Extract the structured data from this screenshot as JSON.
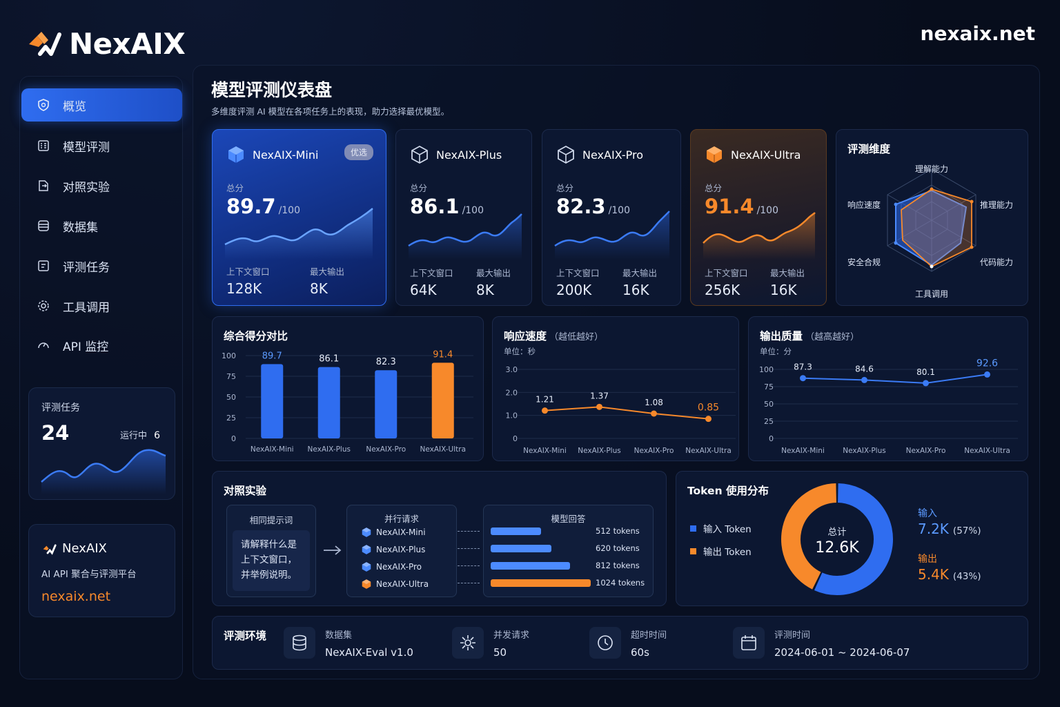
{
  "brand": {
    "logo_text": "NexAIX",
    "domain": "nexaix.net"
  },
  "sidebar": {
    "items": [
      {
        "label": "概览",
        "icon": "shield-icon",
        "active": true
      },
      {
        "label": "模型评测",
        "icon": "grid-icon",
        "active": false
      },
      {
        "label": "对照实验",
        "icon": "compare-icon",
        "active": false
      },
      {
        "label": "数据集",
        "icon": "database-icon",
        "active": false
      },
      {
        "label": "评测任务",
        "icon": "task-icon",
        "active": false
      },
      {
        "label": "工具调用",
        "icon": "gear-icon",
        "active": false
      },
      {
        "label": "API 监控",
        "icon": "gauge-icon",
        "active": false
      }
    ],
    "task_card": {
      "title": "评测任务",
      "count": "24",
      "running_label": "运行中",
      "running_count": "6"
    },
    "brand_card": {
      "name": "NexAIX",
      "tagline": "AI API 聚合与评测平台",
      "url": "nexaix.net"
    }
  },
  "page": {
    "title": "模型评测仪表盘",
    "subtitle": "多维度评测 AI 模型在各项任务上的表现，助力选择最优模型。"
  },
  "models": [
    {
      "name": "NexAIX-Mini",
      "badge": "优选",
      "score_label": "总分",
      "score": "89.7",
      "score_max": "/100",
      "ctx_label": "上下文窗口",
      "ctx": "128K",
      "out_label": "最大输出",
      "out": "8K"
    },
    {
      "name": "NexAIX-Plus",
      "badge": "",
      "score_label": "总分",
      "score": "86.1",
      "score_max": "/100",
      "ctx_label": "上下文窗口",
      "ctx": "64K",
      "out_label": "最大输出",
      "out": "8K"
    },
    {
      "name": "NexAIX-Pro",
      "badge": "",
      "score_label": "总分",
      "score": "82.3",
      "score_max": "/100",
      "ctx_label": "上下文窗口",
      "ctx": "200K",
      "out_label": "最大输出",
      "out": "16K"
    },
    {
      "name": "NexAIX-Ultra",
      "badge": "",
      "score_label": "总分",
      "score": "91.4",
      "score_max": "/100",
      "ctx_label": "上下文窗口",
      "ctx": "256K",
      "out_label": "最大输出",
      "out": "16K"
    }
  ],
  "radar": {
    "title": "评测维度",
    "axes": [
      "理解能力",
      "推理能力",
      "代码能力",
      "工具调用",
      "安全合规",
      "响应速度"
    ]
  },
  "charts": {
    "score_title": "综合得分对比",
    "speed_title": "响应速度",
    "speed_hint": "（越低越好）",
    "speed_unit": "单位：秒",
    "quality_title": "输出质量",
    "quality_hint": "（越高越好）",
    "quality_unit": "单位：分"
  },
  "chart_data": [
    {
      "type": "bar",
      "title": "综合得分对比",
      "categories": [
        "NexAIX-Mini",
        "NexAIX-Plus",
        "NexAIX-Pro",
        "NexAIX-Ultra"
      ],
      "values": [
        89.7,
        86.1,
        82.3,
        91.4
      ],
      "value_labels": [
        "89.7",
        "86.1",
        "82.3",
        "91.4"
      ],
      "yticks": [
        "0",
        "25",
        "50",
        "75",
        "100"
      ],
      "ylim": [
        0,
        100
      ],
      "colors": [
        "#2f6df0",
        "#2f6df0",
        "#2f6df0",
        "#f7892b"
      ]
    },
    {
      "type": "line",
      "title": "响应速度",
      "categories": [
        "NexAIX-Mini",
        "NexAIX-Plus",
        "NexAIX-Pro",
        "NexAIX-Ultra"
      ],
      "values": [
        1.21,
        1.37,
        1.08,
        0.85
      ],
      "value_labels": [
        "1.21",
        "1.37",
        "1.08",
        "0.85"
      ],
      "yticks": [
        "0",
        "1.0",
        "2.0",
        "3.0"
      ],
      "ylim": [
        0,
        3.0
      ],
      "color": "#f7892b"
    },
    {
      "type": "line",
      "title": "输出质量",
      "categories": [
        "NexAIX-Mini",
        "NexAIX-Plus",
        "NexAIX-Pro",
        "NexAIX-Ultra"
      ],
      "values": [
        87.3,
        84.6,
        80.1,
        92.6
      ],
      "value_labels": [
        "87.3",
        "84.6",
        "80.1",
        "92.6"
      ],
      "yticks": [
        "0",
        "25",
        "50",
        "75",
        "100"
      ],
      "ylim": [
        0,
        100
      ],
      "color": "#3b7bf5"
    },
    {
      "type": "pie",
      "title": "Token 使用分布",
      "labels": [
        "输入 Token",
        "输出 Token"
      ],
      "values": [
        57,
        43
      ],
      "colors": [
        "#2f6df0",
        "#f7892b"
      ]
    }
  ],
  "experiment": {
    "title": "对照实验",
    "prompt_header": "相同提示词",
    "prompt_text": [
      "请解释什么是",
      "上下文窗口，",
      "并举例说明。"
    ],
    "parallel_header": "并行请求",
    "answer_header": "模型回答",
    "rows": [
      {
        "model": "NexAIX-Mini",
        "tokens": 512,
        "tokens_label": "512 tokens"
      },
      {
        "model": "NexAIX-Plus",
        "tokens": 620,
        "tokens_label": "620 tokens"
      },
      {
        "model": "NexAIX-Pro",
        "tokens": 812,
        "tokens_label": "812 tokens"
      },
      {
        "model": "NexAIX-Ultra",
        "tokens": 1024,
        "tokens_label": "1024 tokens"
      }
    ]
  },
  "token": {
    "title": "Token 使用分布",
    "legend_in": "输入 Token",
    "legend_out": "输出 Token",
    "total_label": "总计",
    "total": "12.6K",
    "in_label": "输入",
    "in_value": "7.2K",
    "in_pct": "(57%)",
    "out_label": "输出",
    "out_value": "5.4K",
    "out_pct": "(43%)"
  },
  "env": {
    "title": "评测环境",
    "items": [
      {
        "label": "数据集",
        "value": "NexAIX-Eval v1.0",
        "icon": "database-icon"
      },
      {
        "label": "并发请求",
        "value": "50",
        "icon": "network-icon"
      },
      {
        "label": "超时时间",
        "value": "60s",
        "icon": "clock-icon"
      },
      {
        "label": "评测时间",
        "value": "2024-06-01 ~ 2024-06-07",
        "icon": "calendar-icon"
      }
    ]
  },
  "colors": {
    "accent_blue": "#2f6df0",
    "accent_orange": "#f7892b",
    "background": "#070d1c"
  }
}
